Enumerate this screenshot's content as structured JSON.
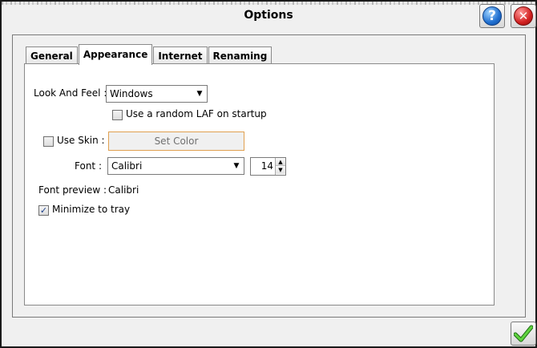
{
  "window": {
    "title": "Options"
  },
  "icons": {
    "help": "question-mark-icon",
    "close": "close-x-icon",
    "ok": "checkmark-icon",
    "colors": {
      "help": "#1f6fd0",
      "close": "#d22020",
      "ok": "#3aa82a",
      "setcolor_border": "#e0a050"
    }
  },
  "tabs": [
    {
      "label": "General"
    },
    {
      "label": "Appearance",
      "active": true
    },
    {
      "label": "Internet"
    },
    {
      "label": "Renaming"
    }
  ],
  "appearance": {
    "laf_label": "Look And Feel :",
    "laf_value": "Windows",
    "random_laf_label": "Use a random LAF on startup",
    "random_laf_checked": false,
    "use_skin_label": "Use Skin :",
    "use_skin_checked": false,
    "set_color_label": "Set Color",
    "font_label": "Font :",
    "font_value": "Calibri",
    "font_size": "14",
    "font_preview_label": "Font preview :",
    "font_preview_value": "Calibri",
    "minimize_label": "Minimize to tray",
    "minimize_checked": true
  },
  "glyphs": {
    "help": "?",
    "close": "✕",
    "check": "✓",
    "down": "▼",
    "up": "▲"
  }
}
